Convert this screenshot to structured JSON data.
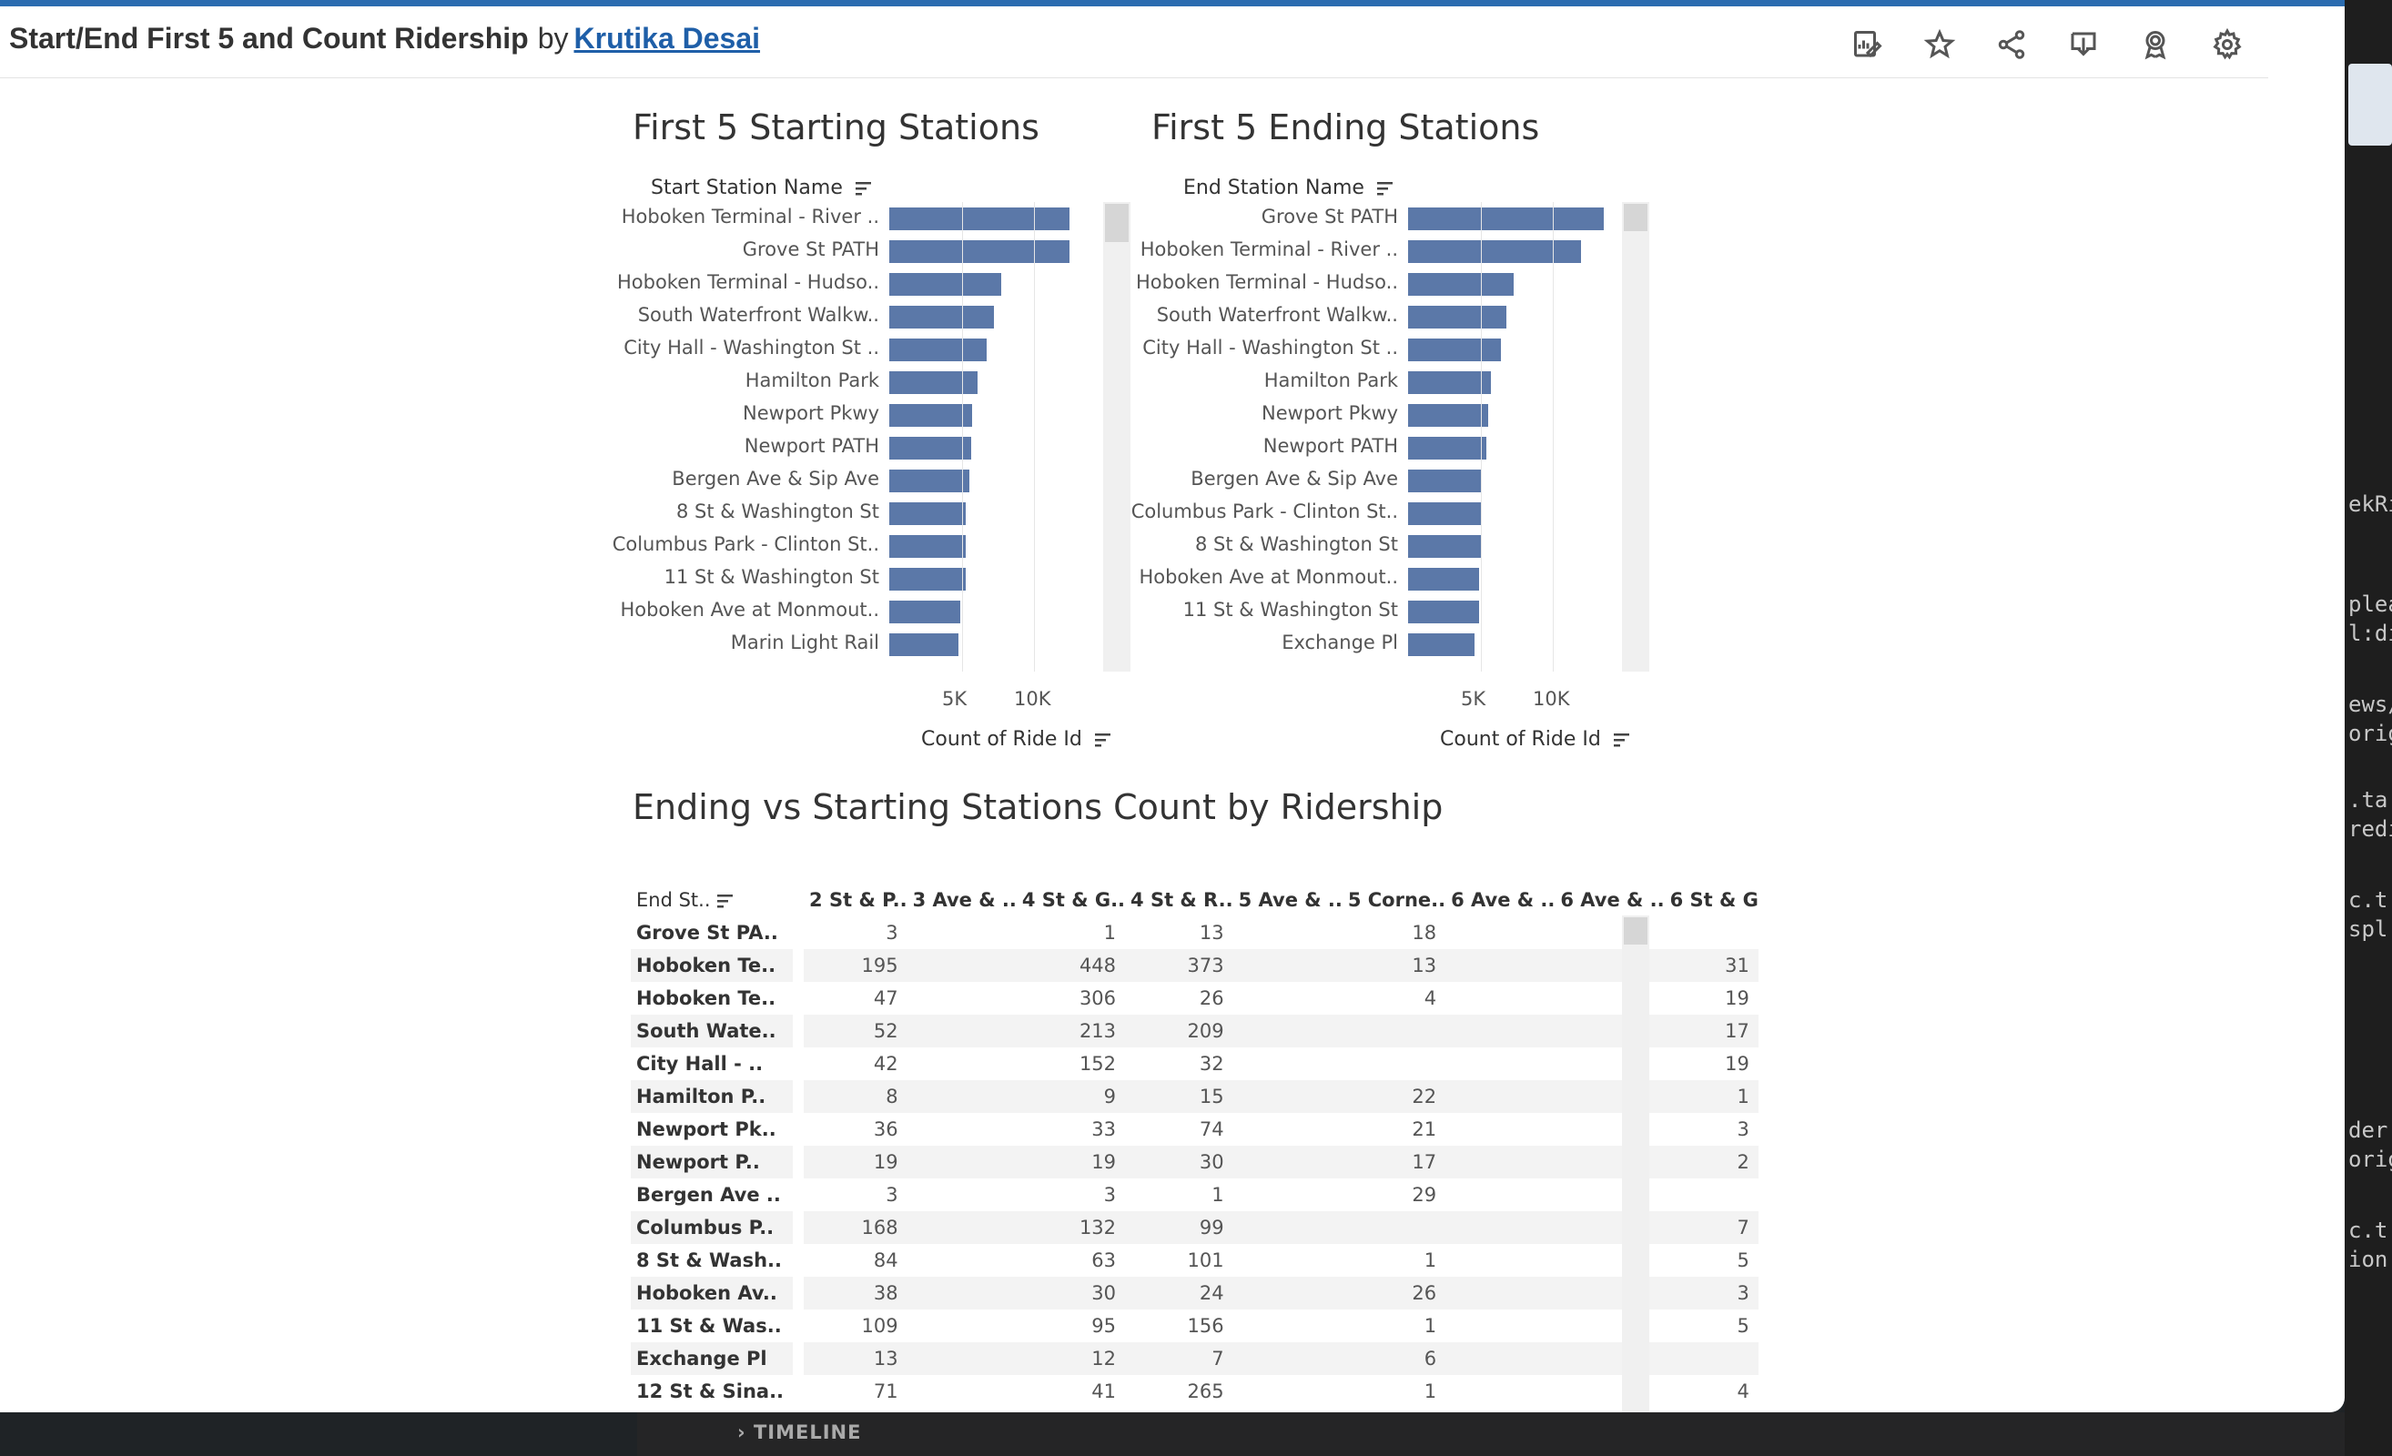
{
  "header": {
    "title": "Start/End First 5 and Count Ridership",
    "by": "by",
    "author": "Krutika Desai"
  },
  "toolbar": {
    "icons": [
      "edit-chart-icon",
      "favorite-star-icon",
      "share-icon",
      "download-icon",
      "award-icon",
      "settings-gear-icon"
    ]
  },
  "start_chart": {
    "title": "First 5 Starting Stations",
    "field_label": "Start Station Name",
    "axis_title": "Count of Ride Id",
    "ticks": [
      "5K",
      "10K"
    ],
    "stations": [
      {
        "name": "Hoboken Terminal - River ..",
        "value": 12400
      },
      {
        "name": "Grove St PATH",
        "value": 12400
      },
      {
        "name": "Hoboken Terminal - Hudso..",
        "value": 7700
      },
      {
        "name": "South Waterfront Walkw..",
        "value": 7200
      },
      {
        "name": "City Hall - Washington St ..",
        "value": 6700
      },
      {
        "name": "Hamilton Park",
        "value": 6100
      },
      {
        "name": "Newport Pkwy",
        "value": 5700
      },
      {
        "name": "Newport PATH",
        "value": 5650
      },
      {
        "name": "Bergen Ave & Sip Ave",
        "value": 5550
      },
      {
        "name": "8 St & Washington St",
        "value": 5300
      },
      {
        "name": "Columbus Park - Clinton St..",
        "value": 5250
      },
      {
        "name": "11 St & Washington St",
        "value": 5250
      },
      {
        "name": "Hoboken Ave at Monmout..",
        "value": 4900
      },
      {
        "name": "Marin Light Rail",
        "value": 4800
      }
    ]
  },
  "end_chart": {
    "title": "First 5 Ending Stations",
    "field_label": "End Station Name",
    "axis_title": "Count of Ride Id",
    "ticks": [
      "5K",
      "10K"
    ],
    "stations": [
      {
        "name": "Grove St PATH",
        "value": 13500
      },
      {
        "name": "Hoboken Terminal - River ..",
        "value": 11900
      },
      {
        "name": "Hoboken Terminal - Hudso..",
        "value": 7300
      },
      {
        "name": "South Waterfront Walkw..",
        "value": 6800
      },
      {
        "name": "City Hall - Washington St ..",
        "value": 6400
      },
      {
        "name": "Hamilton Park",
        "value": 5700
      },
      {
        "name": "Newport Pkwy",
        "value": 5500
      },
      {
        "name": "Newport PATH",
        "value": 5400
      },
      {
        "name": "Bergen Ave & Sip Ave",
        "value": 5100
      },
      {
        "name": "Columbus Park - Clinton St..",
        "value": 5100
      },
      {
        "name": "8 St & Washington St",
        "value": 5000
      },
      {
        "name": "Hoboken Ave at Monmout..",
        "value": 4900
      },
      {
        "name": "11 St & Washington St",
        "value": 4900
      },
      {
        "name": "Exchange Pl",
        "value": 4600
      }
    ]
  },
  "pivot": {
    "title": "Ending vs Starting Stations Count by Ridership",
    "row_header": "End St..",
    "columns": [
      "2 St & P..",
      "3 Ave & ..",
      "4 St & G..",
      "4 St & R..",
      "5 Ave & ..",
      "5 Corne..",
      "6 Ave & ..",
      "6 Ave & ..",
      "6 St & G"
    ],
    "rows": [
      {
        "name": "Grove St PA..",
        "values": [
          "3",
          "",
          "1",
          "13",
          "",
          "18",
          "",
          "",
          ""
        ]
      },
      {
        "name": "Hoboken Te..",
        "values": [
          "195",
          "",
          "448",
          "373",
          "",
          "13",
          "",
          "",
          "31"
        ]
      },
      {
        "name": "Hoboken Te..",
        "values": [
          "47",
          "",
          "306",
          "26",
          "",
          "4",
          "",
          "",
          "19"
        ]
      },
      {
        "name": "South Wate..",
        "values": [
          "52",
          "",
          "213",
          "209",
          "",
          "",
          "",
          "",
          "17"
        ]
      },
      {
        "name": "City Hall - ..",
        "values": [
          "42",
          "",
          "152",
          "32",
          "",
          "",
          "",
          "",
          "19"
        ]
      },
      {
        "name": "Hamilton P..",
        "values": [
          "8",
          "",
          "9",
          "15",
          "",
          "22",
          "",
          "",
          "1"
        ]
      },
      {
        "name": "Newport Pk..",
        "values": [
          "36",
          "",
          "33",
          "74",
          "",
          "21",
          "",
          "",
          "3"
        ]
      },
      {
        "name": "Newport P..",
        "values": [
          "19",
          "",
          "19",
          "30",
          "",
          "17",
          "",
          "",
          "2"
        ]
      },
      {
        "name": "Bergen Ave ..",
        "values": [
          "3",
          "",
          "3",
          "1",
          "",
          "29",
          "",
          "",
          ""
        ]
      },
      {
        "name": "Columbus P..",
        "values": [
          "168",
          "",
          "132",
          "99",
          "",
          "",
          "",
          "",
          "7"
        ]
      },
      {
        "name": "8 St & Wash..",
        "values": [
          "84",
          "",
          "63",
          "101",
          "",
          "1",
          "",
          "",
          "5"
        ]
      },
      {
        "name": "Hoboken Av..",
        "values": [
          "38",
          "",
          "30",
          "24",
          "",
          "26",
          "",
          "",
          "3"
        ]
      },
      {
        "name": "11 St & Was..",
        "values": [
          "109",
          "",
          "95",
          "156",
          "",
          "1",
          "",
          "",
          "5"
        ]
      },
      {
        "name": "Exchange Pl",
        "values": [
          "13",
          "",
          "12",
          "7",
          "",
          "6",
          "",
          "",
          ""
        ]
      },
      {
        "name": "12 St & Sina..",
        "values": [
          "71",
          "",
          "41",
          "265",
          "",
          "1",
          "",
          "",
          "4"
        ]
      }
    ]
  },
  "bottom_panel": {
    "label": "TIMELINE"
  },
  "right_fragments": [
    "ekRi",
    "plea",
    "l:di",
    "ews/",
    "orig",
    ".ta",
    "redi",
    "c.t",
    "spl",
    "der",
    "orig",
    "c.t",
    "ion"
  ],
  "colors": {
    "bar": "#5b78a8",
    "accent_top": "#2b6cb0",
    "link": "#1f5fa8"
  }
}
